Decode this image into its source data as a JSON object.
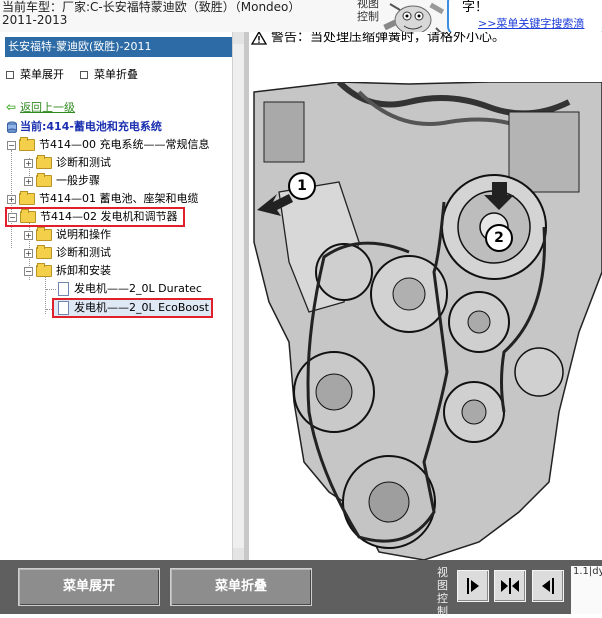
{
  "header": {
    "line1": "当前车型：厂家:C-长安福特蒙迪欧（致胜）（Mondeo）",
    "line2": "2011-2013",
    "view_label": "视图控制",
    "bubble_text": "字！",
    "bubble_link": ">>菜单关键字搜索滴"
  },
  "tree": {
    "title": "长安福特-蒙迪欧(致胜)-2011",
    "expand_label": "菜单展开",
    "collapse_label": "菜单折叠",
    "back_label": "返回上一级",
    "current_label": "当前:414-蓄电池和充电系统",
    "items": [
      {
        "label": "节414—00 充电系统——常规信息",
        "sign": "−"
      },
      {
        "label": "诊断和测试",
        "sign": "+"
      },
      {
        "label": "一般步骤",
        "sign": "+"
      },
      {
        "label": "节414—01 蓄电池、座架和电缆",
        "sign": "+"
      },
      {
        "label": "节414—02 发电机和调节器",
        "sign": "−"
      },
      {
        "label": "说明和操作",
        "sign": "+"
      },
      {
        "label": "诊断和测试",
        "sign": "+"
      },
      {
        "label": "拆卸和安装",
        "sign": "−"
      },
      {
        "label": "发电机——2_0L Duratec"
      },
      {
        "label": "发电机——2_0L EcoBoost"
      }
    ]
  },
  "content": {
    "warning": "警告：当处理压缩弹簧时，请格外小心。",
    "callout1": "1",
    "callout2": "2"
  },
  "bottom": {
    "expand_button": "菜单展开",
    "collapse_button": "菜单折叠",
    "view_label": "视图控制",
    "right_text": "1.1|dy"
  },
  "colors": {
    "title_bar": "#2c6ba6",
    "current_text": "#1a2fb0",
    "back_link": "#2f8a1f",
    "highlight_border": "#e0202a",
    "bottom_bar": "#5f5f5f",
    "bubble_border": "#3a8de0",
    "link": "#1c3cd8"
  }
}
